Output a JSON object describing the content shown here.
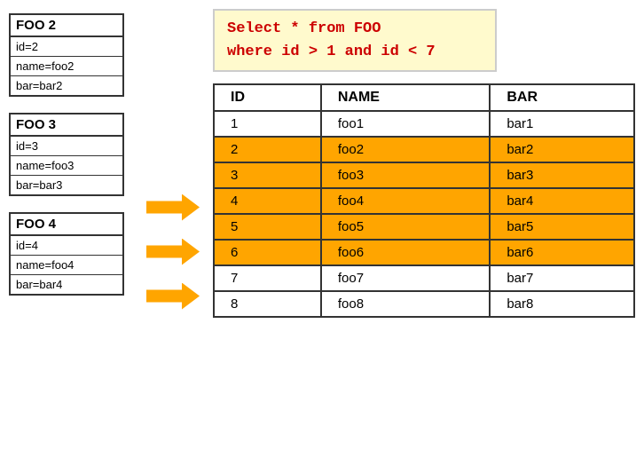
{
  "sql": {
    "line1": "Select * from FOO",
    "line2": "where id > 1 and id < 7"
  },
  "foo_cards": [
    {
      "header": "FOO 2",
      "rows": [
        "id=2",
        "name=foo2",
        "bar=bar2"
      ]
    },
    {
      "header": "FOO 3",
      "rows": [
        "id=3",
        "name=foo3",
        "bar=bar3"
      ]
    },
    {
      "header": "FOO 4",
      "rows": [
        "id=4",
        "name=foo4",
        "bar=bar4"
      ]
    }
  ],
  "table": {
    "headers": [
      "ID",
      "NAME",
      "BAR"
    ],
    "rows": [
      {
        "id": "1",
        "name": "foo1",
        "bar": "bar1",
        "highlighted": false
      },
      {
        "id": "2",
        "name": "foo2",
        "bar": "bar2",
        "highlighted": true
      },
      {
        "id": "3",
        "name": "foo3",
        "bar": "bar3",
        "highlighted": true
      },
      {
        "id": "4",
        "name": "foo4",
        "bar": "bar4",
        "highlighted": true
      },
      {
        "id": "5",
        "name": "foo5",
        "bar": "bar5",
        "highlighted": true
      },
      {
        "id": "6",
        "name": "foo6",
        "bar": "bar6",
        "highlighted": true
      },
      {
        "id": "7",
        "name": "foo7",
        "bar": "bar7",
        "highlighted": false
      },
      {
        "id": "8",
        "name": "foo8",
        "bar": "bar8",
        "highlighted": false
      }
    ]
  },
  "arrows": [
    "arrow1",
    "arrow2",
    "arrow3"
  ]
}
